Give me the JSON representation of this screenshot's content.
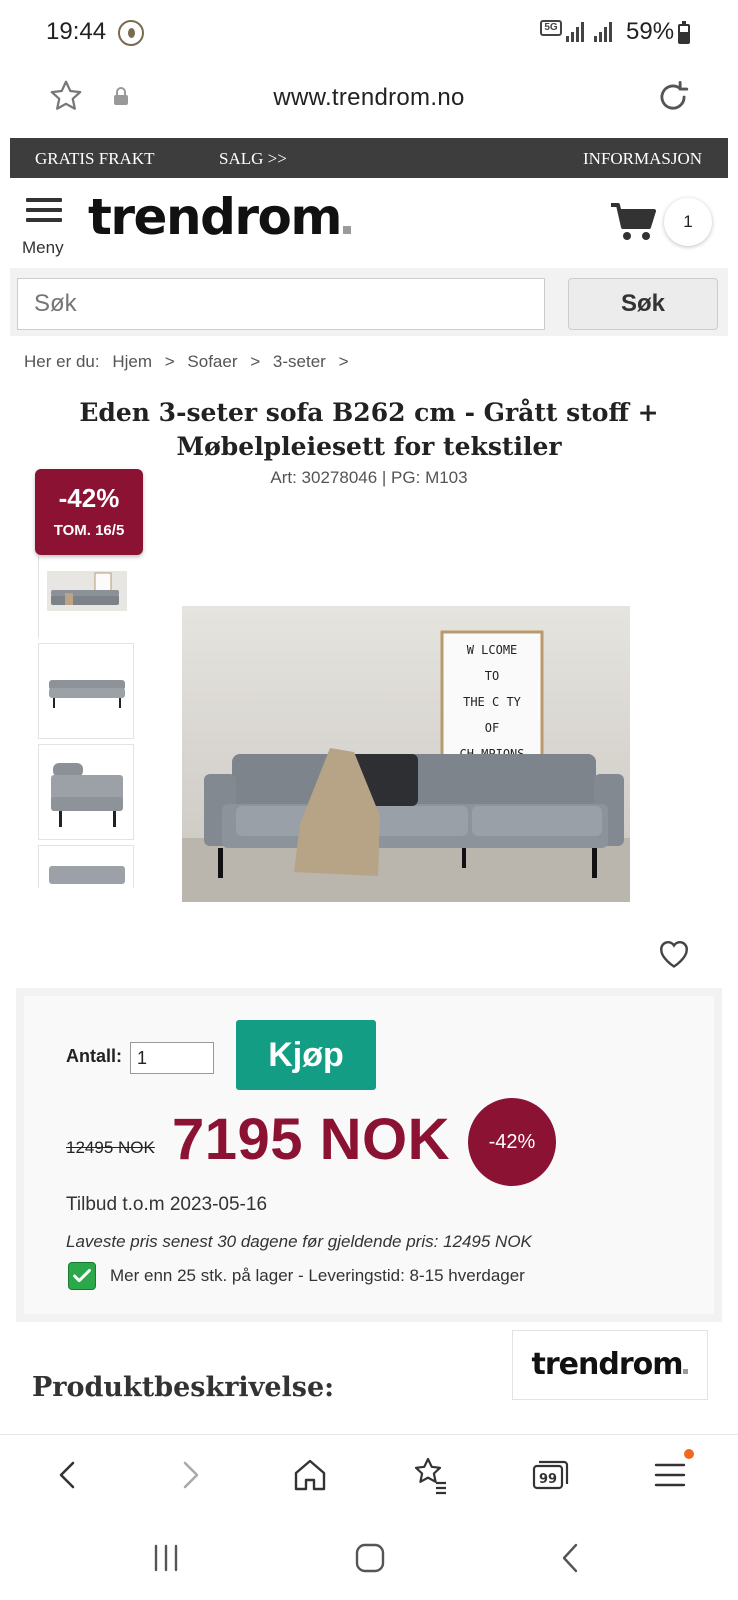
{
  "status_bar": {
    "time": "19:44",
    "network_label": "5G",
    "battery": "59%"
  },
  "address_bar": {
    "url": "www.trendrom.no"
  },
  "promo_strip": {
    "free_shipping": "GRATIS FRAKT",
    "sale": "SALG >>",
    "info": "INFORMASJON"
  },
  "header": {
    "menu_label": "Meny",
    "logo_text": "trendrom",
    "cart_count": "1"
  },
  "search": {
    "placeholder": "Søk",
    "button_label": "Søk"
  },
  "breadcrumb": {
    "prefix": "Her er du:",
    "items": [
      "Hjem",
      "Sofaer",
      "3-seter"
    ],
    "separator": ">"
  },
  "product": {
    "title": "Eden 3-seter sofa B262 cm - Grått stoff + Møbelpleiesett for tekstiler",
    "article_line": "Art: 30278046 | PG: M103",
    "discount_tag": "-42%",
    "discount_until": "TOM. 16/5",
    "poster_lines": [
      "W LCOME",
      "TO",
      "THE C TY",
      "OF",
      "CH MPIONS"
    ]
  },
  "buy_box": {
    "quantity_label": "Antall:",
    "quantity_value": "1",
    "buy_button": "Kjøp",
    "old_price": "12495 NOK",
    "new_price": "7195 NOK",
    "discount_badge": "-42%",
    "offer_text": "Tilbud t.o.m 2023-05-16",
    "lowest_price_text": "Laveste pris senest 30 dagene før gjeldende pris: 12495 NOK",
    "stock_text": "Mer enn 25 stk. på lager - Leveringstid: 8-15 hverdager"
  },
  "description": {
    "heading": "Produktbeskrivelse:",
    "logo_text": "trendrom"
  },
  "browser_nav": {
    "tabs_count": "99"
  },
  "colors": {
    "brand_red": "#8b1232",
    "buy_green": "#149d85",
    "promo_dark": "#3d3d3d",
    "notification_orange": "#f06a1e"
  }
}
